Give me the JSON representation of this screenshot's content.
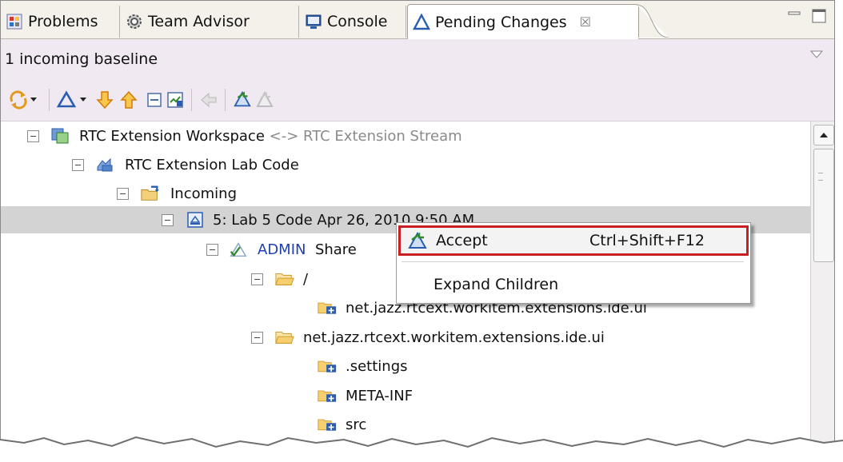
{
  "tabs": [
    {
      "label": "Problems",
      "icon": "problems-icon"
    },
    {
      "label": "Team Advisor",
      "icon": "team-advisor-icon"
    },
    {
      "label": "Console",
      "icon": "console-icon"
    },
    {
      "label": "Pending Changes",
      "icon": "pending-changes-icon",
      "active": true,
      "close_glyph": "☒"
    }
  ],
  "header": {
    "status": "1 incoming baseline"
  },
  "toolbar": {
    "icons": [
      "synchronize-icon",
      "dropdown-icon",
      "change-set-icon",
      "dropdown-icon",
      "accept-down-arrow-icon",
      "deliver-up-arrow-icon",
      "collapse-all-icon",
      "expand-icon",
      "disabled-action-icon",
      "accept-incoming-icon",
      "disabled-accept-icon"
    ]
  },
  "tree": {
    "rows": [
      {
        "label": "RTC Extension Workspace",
        "suffix": " <-> RTC Extension Stream",
        "icon": "workspace-icon"
      },
      {
        "label": "RTC Extension Lab Code",
        "icon": "component-icon"
      },
      {
        "label": "Incoming",
        "icon": "incoming-folder-icon"
      },
      {
        "label": "5: Lab 5 Code  Apr 26, 2010 9:50 AM",
        "icon": "baseline-icon",
        "selected": true
      },
      {
        "author": "ADMIN",
        "label": "Share",
        "icon": "change-set-icon"
      },
      {
        "label": "/",
        "icon": "folder-icon"
      },
      {
        "label": "net.jazz.rtcext.workitem.extensions.ide.ui",
        "icon": "new-folder-icon"
      },
      {
        "label": "net.jazz.rtcext.workitem.extensions.ide.ui",
        "icon": "folder-icon"
      },
      {
        "label": ".settings",
        "icon": "new-folder-icon"
      },
      {
        "label": "META-INF",
        "icon": "new-folder-icon"
      },
      {
        "label": "src",
        "icon": "new-folder-icon"
      }
    ]
  },
  "context_menu": {
    "items": [
      {
        "label": "Accept",
        "shortcut": "Ctrl+Shift+F12",
        "icon": "accept-icon",
        "highlighted": true
      },
      {
        "label": "Expand Children"
      }
    ]
  },
  "colors": {
    "header_bg": "#f0e9f1",
    "selection": "#d3d3d3",
    "highlight_border": "#c71f22",
    "author_blue": "#1f3fb0"
  }
}
